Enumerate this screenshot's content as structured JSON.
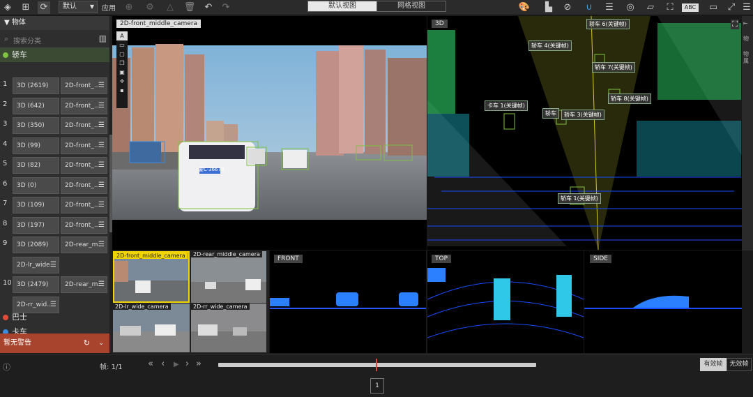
{
  "toolbar": {
    "preset_value": "默认",
    "apply_label": "应用",
    "view_default": "默认视图",
    "view_grid": "网格视图",
    "abc_label": "ABC"
  },
  "sidebar": {
    "section_title": "物体",
    "search_placeholder": "搜索分类",
    "category_sedan": "轿车",
    "category_bus": "巴士",
    "category_truck": "卡车",
    "rows": [
      {
        "num": "1",
        "a": "3D  (2619)",
        "b": "2D-front_..."
      },
      {
        "num": "2",
        "a": "3D  (642)",
        "b": "2D-front_..."
      },
      {
        "num": "3",
        "a": "3D  (350)",
        "b": "2D-front_..."
      },
      {
        "num": "4",
        "a": "3D  (99)",
        "b": "2D-front_..."
      },
      {
        "num": "5",
        "a": "3D  (82)",
        "b": "2D-front_..."
      },
      {
        "num": "6",
        "a": "3D  (0)",
        "b": "2D-front_..."
      },
      {
        "num": "7",
        "a": "3D  (109)",
        "b": "2D-front_..."
      },
      {
        "num": "8",
        "a": "3D  (197)",
        "b": "2D-front_..."
      },
      {
        "num": "9",
        "a": "3D  (2089)",
        "b": "2D-rear_m...",
        "c": "2D-lr_wide..."
      },
      {
        "num": "10",
        "a": "3D  (2479)",
        "b": "2D-rear_m...",
        "c": "2D-rr_wid..."
      }
    ],
    "warning": "暂无警告"
  },
  "panels": {
    "main_camera": "2D-front_middle_camera",
    "view3d": "3D",
    "thumb1": "2D-front_middle_camera",
    "thumb2": "2D-rear_middle_camera",
    "thumb3": "2D-lr_wide_camera",
    "thumb4": "2D-rr_wide_camera",
    "front": "FRONT",
    "top": "TOP",
    "side": "SIDE",
    "plate": "蒙C·3667B"
  },
  "labels3d": [
    "轿车 6(关键帧)",
    "轿车 4(关键帧)",
    "轿车 7(关键帧)",
    "轿车 8(关键帧)",
    "卡车 1(关键帧)",
    "轿车",
    "轿车 3(关键帧)",
    "轿车 1(关键帧)"
  ],
  "right_panel": {
    "line1": "物",
    "line2": "物",
    "line3": "属"
  },
  "bottom": {
    "frame_label": "帧:",
    "frame_value": "1/1",
    "tag_valid": "有效帧",
    "tag_invalid": "无效帧",
    "page": "1"
  },
  "colors": {
    "accent_yellow": "#f2d500",
    "warning": "#a8432e",
    "box_green": "#7fc241"
  }
}
